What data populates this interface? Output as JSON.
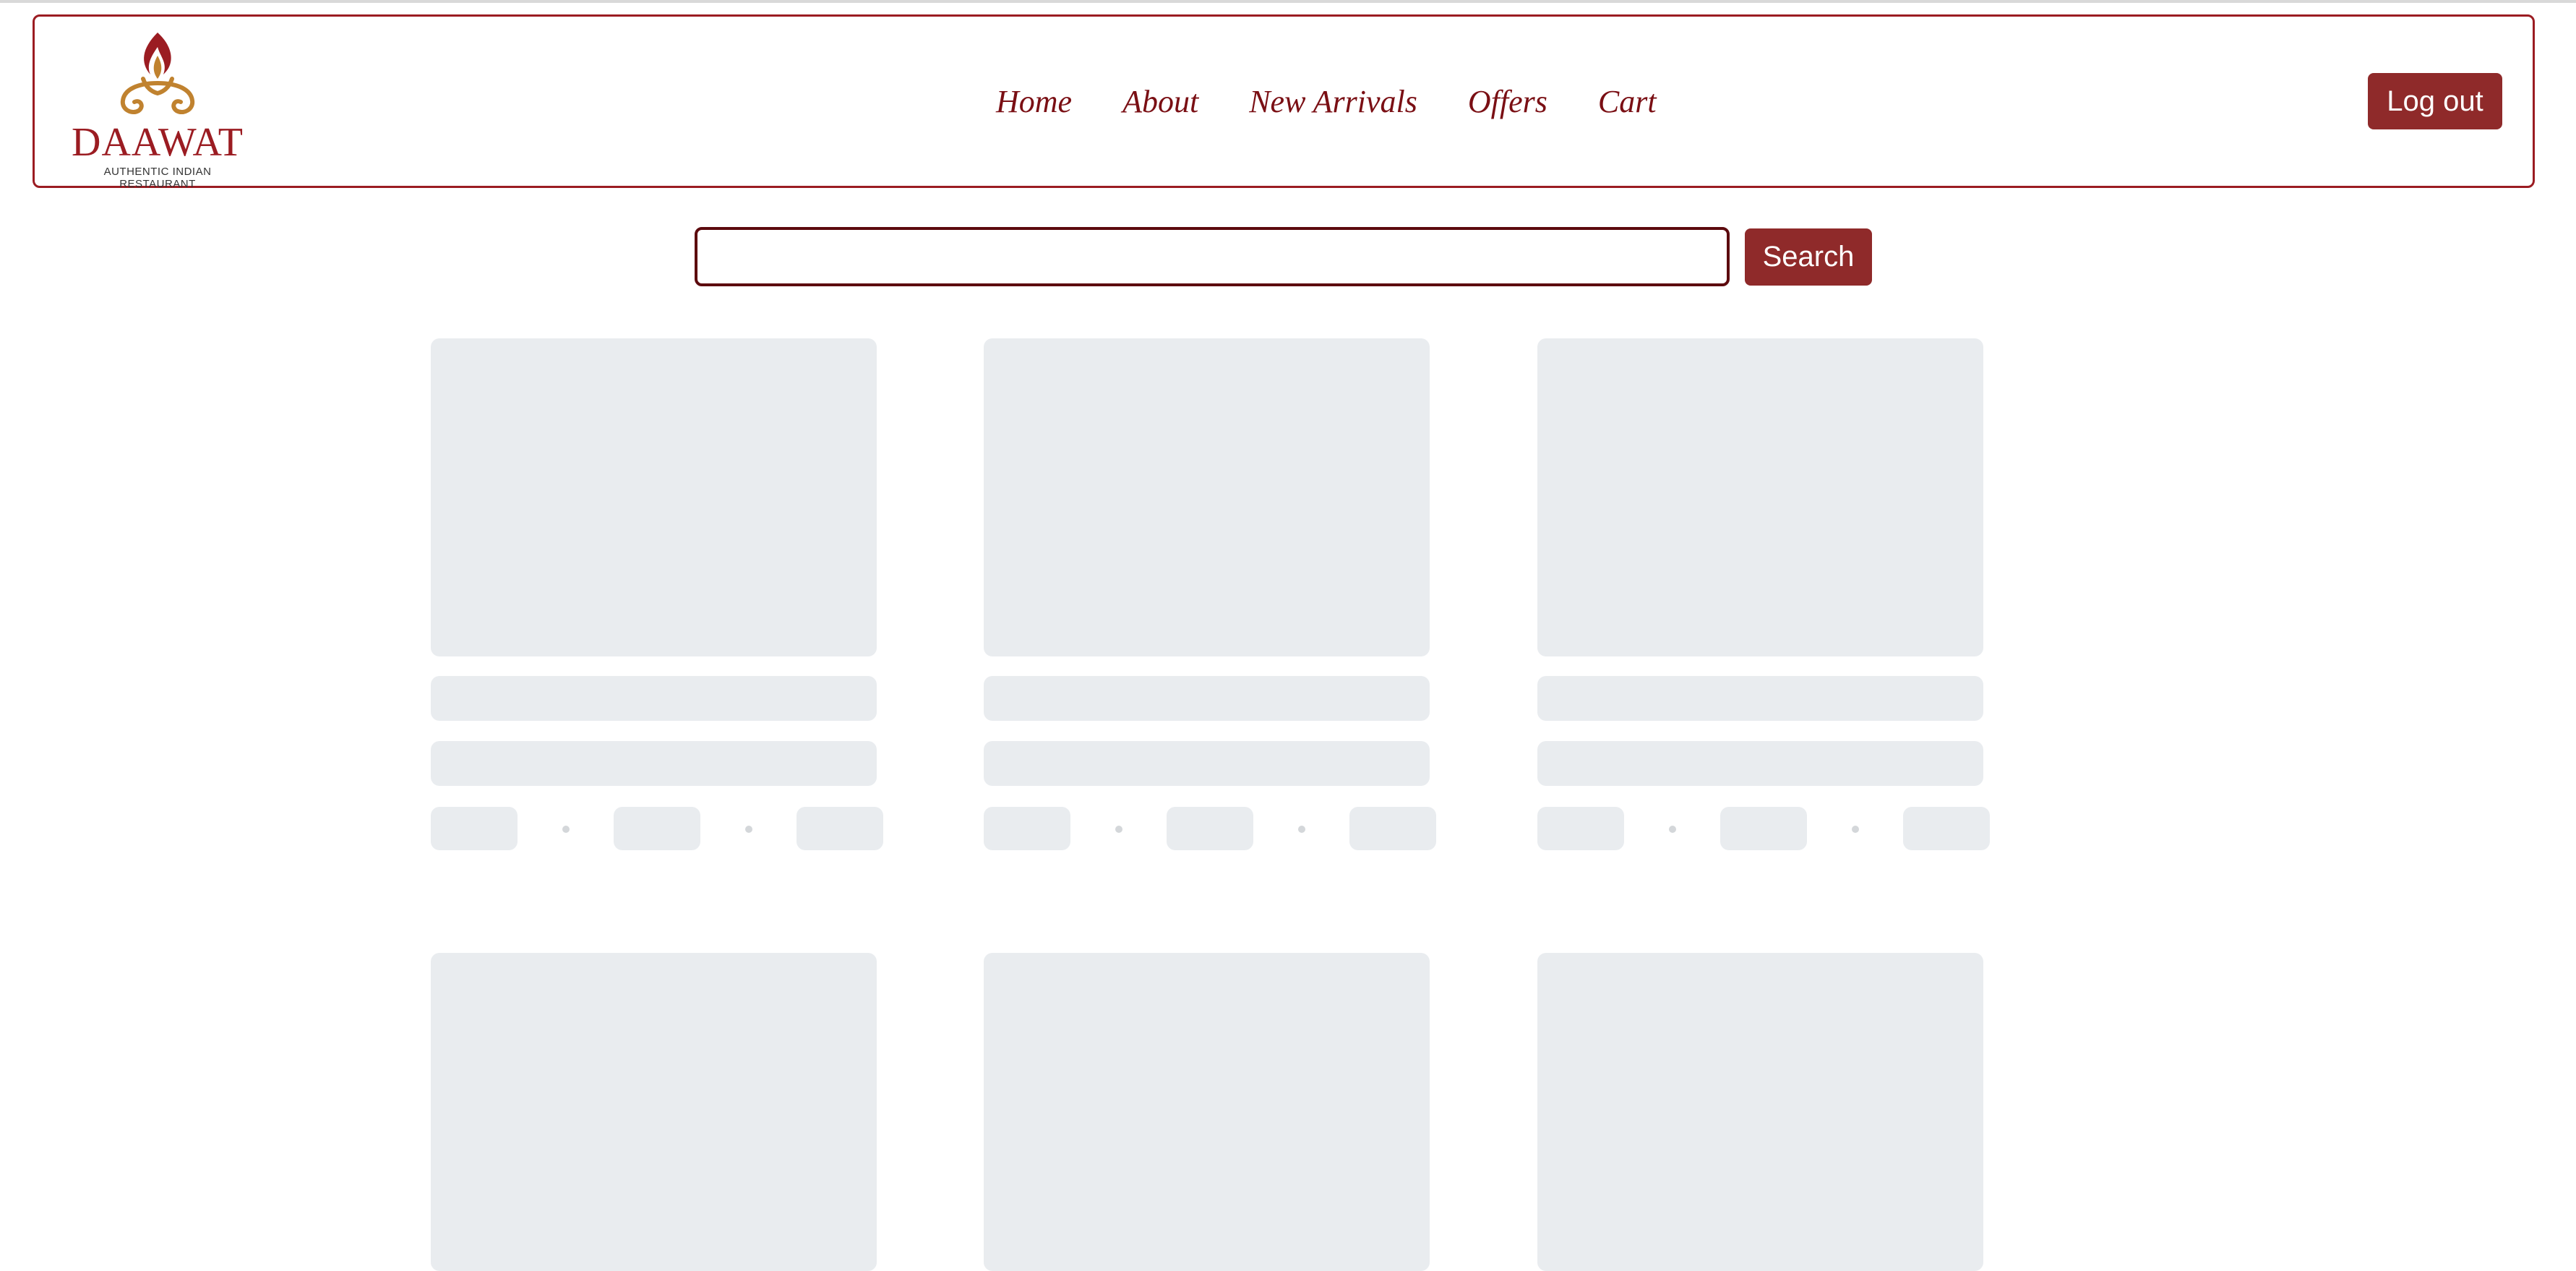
{
  "brand": {
    "name": "DAAWAT",
    "tagline": "AUTHENTIC INDIAN RESTAURANT",
    "logo_icon": "flame-lotus-icon",
    "colors": {
      "primary": "#9b1c22",
      "button": "#8f2a2a",
      "gold": "#c0822f",
      "skeleton": "#e9ecef"
    }
  },
  "nav": {
    "links": [
      "Home",
      "About",
      "New Arrivals",
      "Offers",
      "Cart"
    ],
    "logout_label": "Log out"
  },
  "search": {
    "value": "",
    "button_label": "Search"
  },
  "content": {
    "state": "loading",
    "skeleton_cards": 6
  }
}
